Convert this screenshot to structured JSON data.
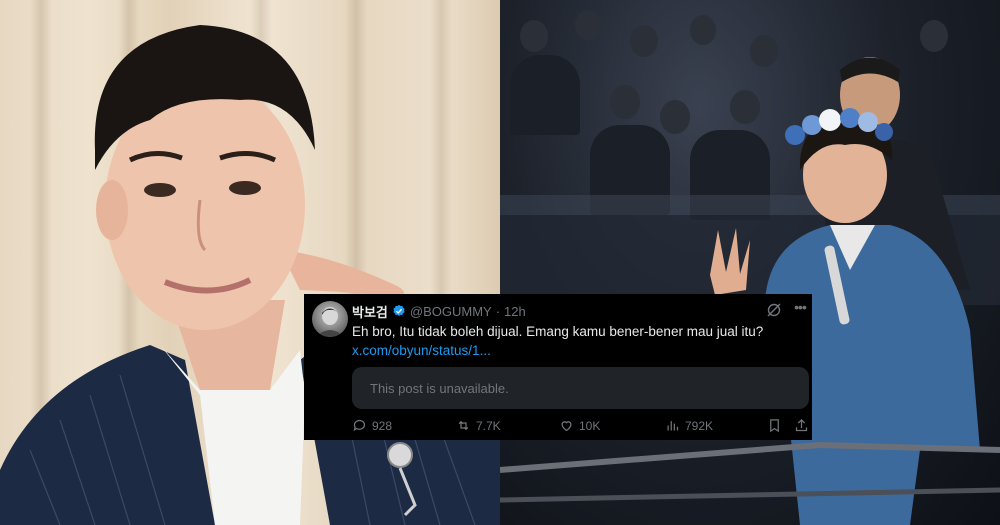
{
  "tweet": {
    "display_name": "박보검",
    "handle": "@BOGUMMY",
    "separator": "·",
    "time": "12h",
    "text": "Eh bro, Itu tidak boleh dijual. Emang kamu bener-bener mau jual itu?",
    "link_text": "x.com/obyun/status/1...",
    "quoted_post_notice": "This post is unavailable.",
    "more_icon_text": "•••",
    "icons": {
      "verified": "verified-badge-icon",
      "grok": "grok-icon",
      "more": "more-icon",
      "reply": "reply-icon",
      "repost": "repost-icon",
      "like": "like-icon",
      "views": "views-icon",
      "bookmark": "bookmark-icon",
      "share": "share-icon"
    },
    "stats": {
      "replies": "928",
      "reposts": "7.7K",
      "likes": "10K",
      "views": "792K"
    },
    "colors": {
      "background": "#000000",
      "text": "#e7e9ea",
      "muted": "#71767b",
      "link": "#1d9bf0",
      "verified": "#1d9bf0",
      "quoted_box": "#202327"
    }
  }
}
